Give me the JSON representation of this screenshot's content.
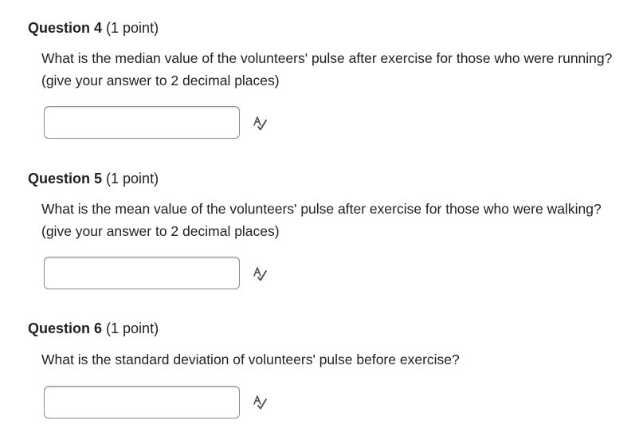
{
  "questions": [
    {
      "title": "Question 4",
      "points": "(1 point)",
      "text": "What is the median value of the volunteers' pulse after exercise for those who were running? (give your answer to 2 decimal places)",
      "answer_value": "",
      "icon": "spellcheck-icon"
    },
    {
      "title": "Question 5",
      "points": "(1 point)",
      "text": "What is the mean value of the volunteers' pulse after exercise for those who were walking? (give your answer to 2 decimal places)",
      "answer_value": "",
      "icon": "spellcheck-icon"
    },
    {
      "title": "Question 6",
      "points": "(1 point)",
      "text": "What is the standard deviation of volunteers' pulse before exercise?",
      "answer_value": "",
      "icon": "spellcheck-icon"
    }
  ]
}
